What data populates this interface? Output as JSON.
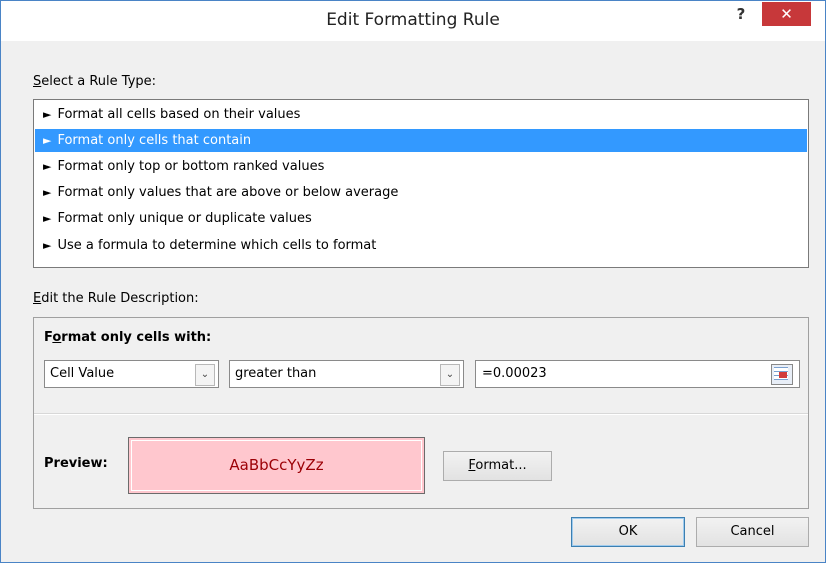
{
  "window": {
    "title": "Edit Formatting Rule",
    "help_label": "?",
    "close_label": "✕"
  },
  "rule_type": {
    "label_mnemonic": "S",
    "label_rest": "elect a Rule Type:",
    "items": [
      {
        "label": "Format all cells based on their values",
        "selected": false
      },
      {
        "label": "Format only cells that contain",
        "selected": true
      },
      {
        "label": "Format only top or bottom ranked values",
        "selected": false
      },
      {
        "label": "Format only values that are above or below average",
        "selected": false
      },
      {
        "label": "Format only unique or duplicate values",
        "selected": false
      },
      {
        "label": "Use a formula to determine which cells to format",
        "selected": false
      }
    ],
    "arrow_icon": "triangle-arrow-icon"
  },
  "description": {
    "label_mnemonic": "E",
    "label_rest": "dit the Rule Description:",
    "format_with_pre": "F",
    "format_with_mnemonic": "o",
    "format_with_rest": "rmat only cells with:",
    "condition_field": {
      "value": "Cell Value"
    },
    "operator_field": {
      "value": "greater than"
    },
    "value_field": {
      "value": "=0.00023"
    },
    "preview_label": "Preview:",
    "preview_text": "AaBbCcYyZz",
    "preview_fill": "#ffc7ce",
    "preview_font_color": "#9c0006",
    "format_button_mnemonic": "F",
    "format_button_rest": "ormat..."
  },
  "footer": {
    "ok_label": "OK",
    "cancel_label": "Cancel"
  },
  "colors": {
    "selection": "#3399ff",
    "close_button": "#c7383a",
    "window_border": "#4a84c6"
  }
}
